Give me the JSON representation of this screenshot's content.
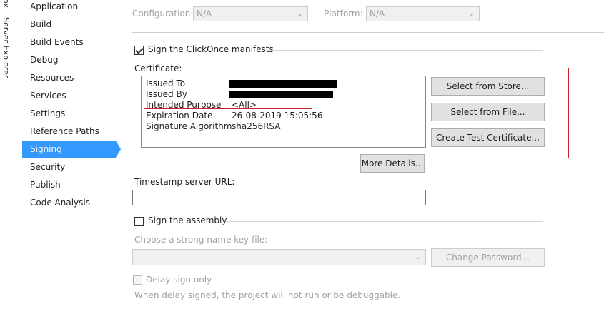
{
  "side_tabs": {
    "partial": "ox",
    "server_explorer": "Server Explorer"
  },
  "nav": {
    "items": [
      {
        "label": "Application"
      },
      {
        "label": "Build"
      },
      {
        "label": "Build Events"
      },
      {
        "label": "Debug"
      },
      {
        "label": "Resources"
      },
      {
        "label": "Services"
      },
      {
        "label": "Settings"
      },
      {
        "label": "Reference Paths"
      },
      {
        "label": "Signing"
      },
      {
        "label": "Security"
      },
      {
        "label": "Publish"
      },
      {
        "label": "Code Analysis"
      }
    ],
    "selected": "Signing"
  },
  "top": {
    "configuration_label": "Configuration:",
    "configuration_value": "N/A",
    "platform_label": "Platform:",
    "platform_value": "N/A"
  },
  "clickonce": {
    "sign_label": "Sign the ClickOnce manifests",
    "sign_checked": true,
    "certificate_label": "Certificate:",
    "fields": [
      {
        "name": "Issued To",
        "value": ""
      },
      {
        "name": "Issued By",
        "value": ""
      },
      {
        "name": "Intended Purpose",
        "value": "<All>"
      },
      {
        "name": "Expiration Date",
        "value": "26-08-2019 15:05:56"
      },
      {
        "name": "Signature Algorithm",
        "value": "sha256RSA"
      }
    ],
    "select_from_store": "Select from Store...",
    "select_from_file": "Select from File...",
    "create_test_certificate": "Create Test Certificate...",
    "more_details": "More Details...",
    "timestamp_label": "Timestamp server URL:",
    "timestamp_value": ""
  },
  "assembly": {
    "sign_label": "Sign the assembly",
    "sign_checked": false,
    "key_file_label": "Choose a strong name key file:",
    "key_file_value": "",
    "change_password": "Change Password...",
    "delay_sign_label": "Delay sign only",
    "delay_note": "When delay signed, the project will not run or be debuggable."
  },
  "colors": {
    "selection": "#3399ff",
    "highlight_outline": "#cc1f2b",
    "disabled_text": "#a0a0a0"
  }
}
